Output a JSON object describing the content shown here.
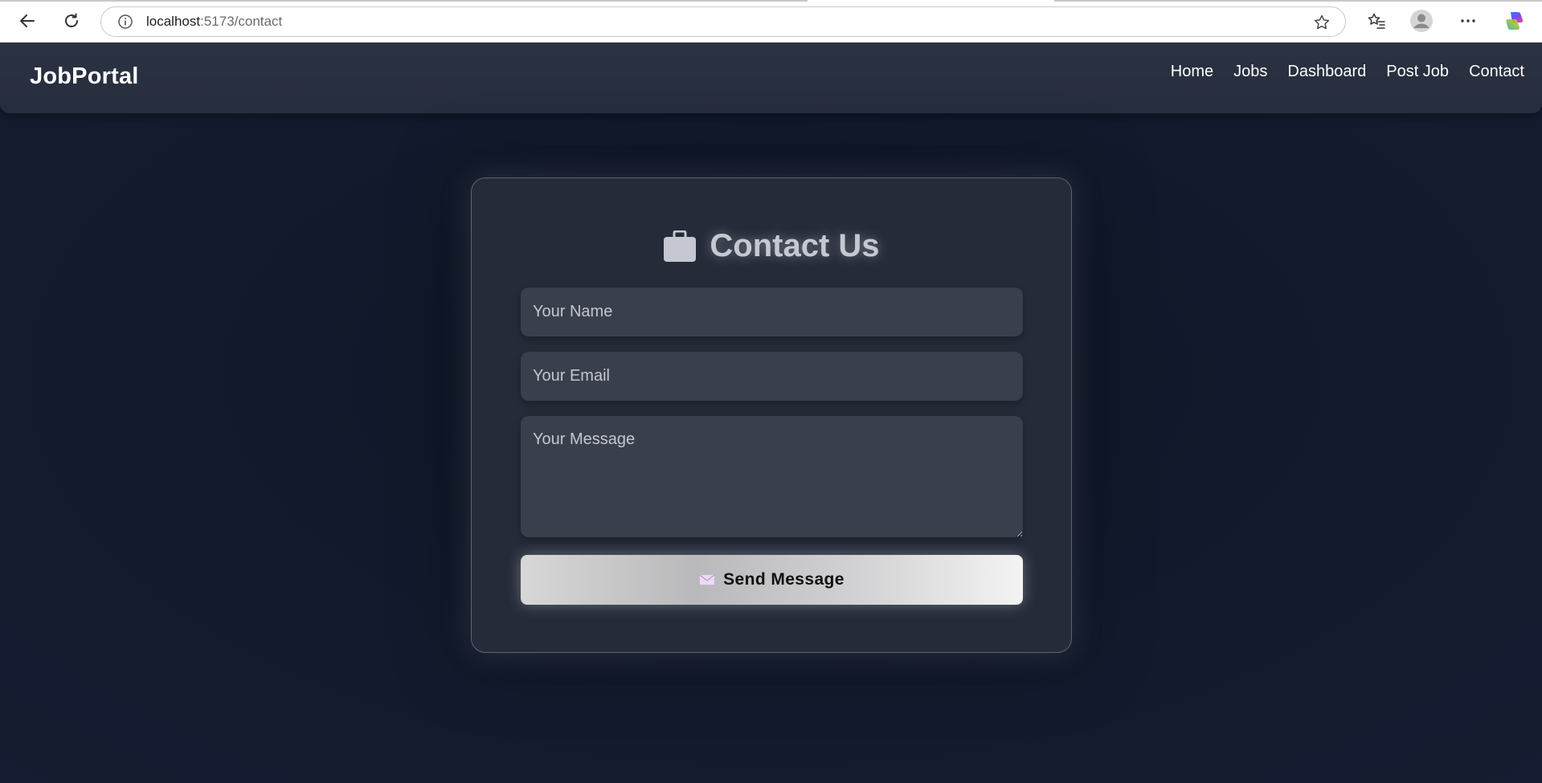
{
  "browser": {
    "url_host": "localhost",
    "url_path": ":5173/contact",
    "icons": [
      "back-icon",
      "reload-icon",
      "info-icon",
      "star-icon",
      "favorites-icon",
      "profile-icon",
      "more-icon",
      "copilot-icon"
    ]
  },
  "navbar": {
    "brand": "JobPortal",
    "links": [
      "Home",
      "Jobs",
      "Dashboard",
      "Post Job",
      "Contact"
    ]
  },
  "contact": {
    "title": "Contact Us",
    "title_icon": "briefcase-icon",
    "name_placeholder": "Your Name",
    "email_placeholder": "Your Email",
    "message_placeholder": "Your Message",
    "submit_label": "Send Message",
    "submit_icon": "envelope-icon"
  },
  "colors": {
    "page_bg": "#121a2b",
    "navbar_bg": "#2b3242",
    "card_bg": "#252b39",
    "field_bg": "#3a3f4d",
    "title_text": "#c5c8d0"
  }
}
